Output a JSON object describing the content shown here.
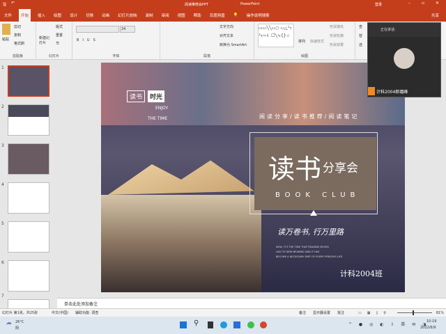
{
  "window": {
    "title": "阅读推荐会PPT",
    "app": "PowerPoint",
    "signin": "登录",
    "share": "共享"
  },
  "tabs": [
    "文件",
    "开始",
    "插入",
    "绘图",
    "设计",
    "切换",
    "动画",
    "幻灯片放映",
    "录制",
    "审阅",
    "视图",
    "帮助",
    "百度网盘"
  ],
  "search_label": "操作说明搜索",
  "ribbon": {
    "clipboard": {
      "label": "剪贴板",
      "paste": "粘贴",
      "cut": "剪切",
      "copy": "复制",
      "format_painter": "格式刷"
    },
    "slides": {
      "label": "幻灯片",
      "new_slide": "新建幻灯片",
      "layout": "版式",
      "reset": "重置",
      "section": "节"
    },
    "font": {
      "label": "字体",
      "size": "24"
    },
    "paragraph": {
      "label": "段落",
      "text_direction": "文字方向",
      "align_text": "对齐文本",
      "smartart": "转换为 SmartArt"
    },
    "drawing": {
      "label": "绘图",
      "arrange": "排列",
      "quick_styles": "快速样式",
      "fill": "形状填充",
      "outline": "形状轮廓",
      "effects": "形状效果"
    },
    "editing": {
      "find": "查",
      "replace": "替",
      "select": "选"
    }
  },
  "video": {
    "status": "正在讲话:",
    "name": "计科2004郎璐峰"
  },
  "slide": {
    "logo_a": "读书",
    "logo_b": "时光",
    "enjoy": "ENJOY",
    "the_time": "THE TIME",
    "subtitle": "阅读分享/读书推荐/阅读笔记",
    "title_big": "读书",
    "title_small": "分享会",
    "book_club": "BOOK CLUB",
    "slogan": "读万卷书, 行万里路",
    "body": [
      "NOW, IT'S THE TIME THAT READING BOOKS",
      "HAS ITS NEW MEANING AND IT HAS",
      "BECOME A NECESSARY PART OF EVERY PERSON'S LIFE."
    ],
    "class": "计科2004班"
  },
  "thumbnails": [
    "1",
    "2",
    "3",
    "4",
    "5",
    "6",
    "7"
  ],
  "notes_placeholder": "单击此处添加备注",
  "status": {
    "slide": "幻灯片 第1张，共25张",
    "lang": "中文(中国)",
    "accessibility": "辅助功能: 调查",
    "notes": "备注",
    "display": "显示器设置",
    "comments": "批注",
    "zoom": "81%",
    "zoom_level": 0.45
  },
  "taskbar": {
    "temp": "26°C",
    "weather": "阴",
    "time": "10:19",
    "date": "2022/6/9"
  },
  "colors": {
    "accent": "#c43e1c",
    "slide_box": "#7a6b5e"
  }
}
